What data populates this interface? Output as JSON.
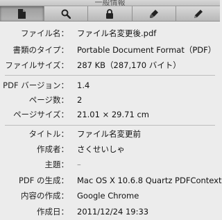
{
  "window": {
    "title": "一般情報"
  },
  "toolbar": {
    "tabs": [
      {
        "icon": "document-icon",
        "active": true
      },
      {
        "icon": "search-icon",
        "active": false
      },
      {
        "icon": "lock-icon",
        "active": false
      },
      {
        "icon": "brush-icon",
        "active": false
      },
      {
        "icon": "pen-icon",
        "active": false
      }
    ]
  },
  "info": {
    "filename": {
      "label": "ファイル名：",
      "value": "ファイル名変更後.pdf"
    },
    "doctype": {
      "label": "書類のタイプ：",
      "value": "Portable Document Format（PDF）"
    },
    "filesize": {
      "label": "ファイルサイズ：",
      "value": "287 KB（287,170 バイト）"
    },
    "pdf_version": {
      "label": "PDF バージョン：",
      "value": "1.4"
    },
    "pages": {
      "label": "ページ数：",
      "value": "2"
    },
    "page_size": {
      "label": "ページサイズ：",
      "value": "21.01 × 29.71 cm"
    },
    "title": {
      "label": "タイトル：",
      "value": "ファイル名変更前"
    },
    "author": {
      "label": "作成者：",
      "value": "さくせいしゃ"
    },
    "subject": {
      "label": "主題：",
      "value": "–"
    },
    "producer": {
      "label": "PDF の生成：",
      "value": "Mac OS X 10.6.8 Quartz PDFContext"
    },
    "creator": {
      "label": "内容の作成：",
      "value": "Google Chrome"
    },
    "created": {
      "label": "作成日：",
      "value": "2011/12/24 19:33"
    }
  }
}
